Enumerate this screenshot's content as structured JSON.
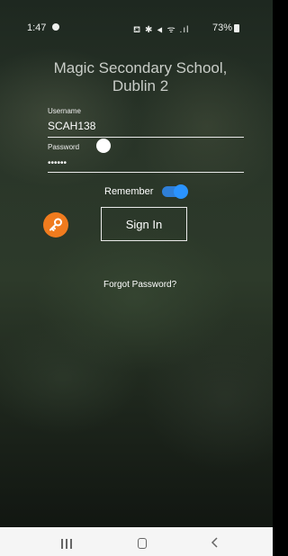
{
  "status_bar": {
    "time": "1:47",
    "icons": "⛾ ✱ ◂ ᯤ .ıl",
    "battery": "73%"
  },
  "login": {
    "school_name": "Magic Secondary School, Dublin 2",
    "username_label": "Username",
    "username_value": "SCAH138",
    "password_label": "Password",
    "password_value": "••••••",
    "remember_label": "Remember",
    "remember_on": true,
    "sign_in_label": "Sign In",
    "forgot_password": "Forgot Password?",
    "accent_color": "#2a93ff",
    "key_button_color": "#f07b1e"
  },
  "nav_bar": {
    "recents": "recents-icon",
    "home": "home-icon",
    "back": "back-icon"
  }
}
